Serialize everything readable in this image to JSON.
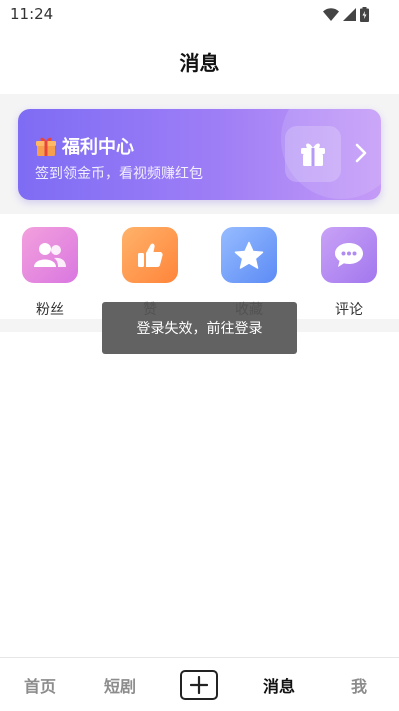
{
  "status_bar": {
    "time": "11:24"
  },
  "header": {
    "title": "消息"
  },
  "welfare_card": {
    "title": "福利中心",
    "subtitle": "签到领金币，看视频赚红包",
    "icons": [
      "gift-emoji-icon",
      "gift-box-icon",
      "chevron-right-icon"
    ]
  },
  "quick_actions": [
    {
      "label": "粉丝",
      "icon": "fans-icon",
      "color_from": "#f08fd8",
      "color_to": "#d97ae0"
    },
    {
      "label": "赞",
      "icon": "thumbs-up-icon",
      "color_from": "#ffab5e",
      "color_to": "#ff8a3c"
    },
    {
      "label": "收藏",
      "icon": "star-icon",
      "color_from": "#8fb6ff",
      "color_to": "#5f8ef6"
    },
    {
      "label": "评论",
      "icon": "comment-icon",
      "color_from": "#c49bf5",
      "color_to": "#a378ee"
    }
  ],
  "toast": {
    "message": "登录失效，前往登录"
  },
  "tab_bar": {
    "tabs": [
      {
        "label": "首页",
        "active": false
      },
      {
        "label": "短剧",
        "active": false
      },
      {
        "label": "消息",
        "active": true
      },
      {
        "label": "我",
        "active": false
      }
    ],
    "add_icon": "plus-icon"
  },
  "colors": {
    "accent_gradient_start": "#7e6cf4",
    "accent_gradient_end": "#c59bf7",
    "background_band": "#f4f4f5",
    "toast_background": "#555555"
  }
}
